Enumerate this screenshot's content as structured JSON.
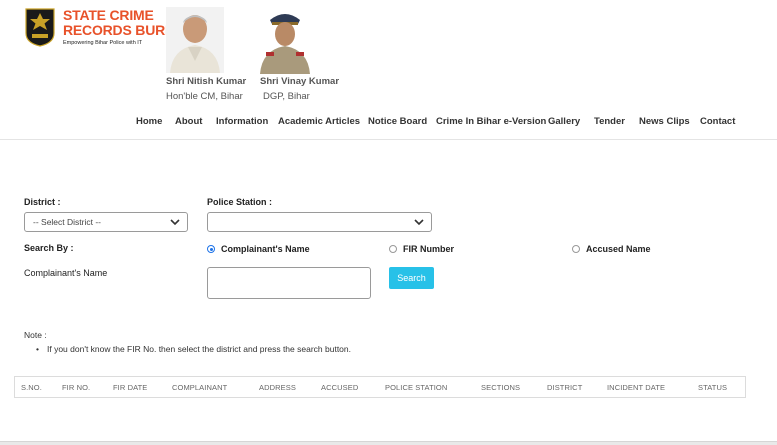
{
  "brand": {
    "line1": "STATE CRIME",
    "line2": "RECORDS BUREAU",
    "tagline": "Empowering Bihar Police with IT",
    "accent_color": "#e8522a",
    "logo_icon": "bihar-police-emblem-icon"
  },
  "officials": [
    {
      "name": "Shri Nitish Kumar",
      "title": "Hon'ble CM, Bihar"
    },
    {
      "name": "Shri Vinay Kumar",
      "title": "DGP, Bihar"
    }
  ],
  "nav": [
    "Home",
    "About",
    "Information",
    "Academic Articles",
    "Notice Board",
    "Crime In Bihar e-Version",
    "Gallery",
    "Tender",
    "News Clips",
    "Contact"
  ],
  "form": {
    "district_label": "District :",
    "district_value": "-- Select District --",
    "police_station_label": "Police Station :",
    "police_station_value": "",
    "search_by_label": "Search By :",
    "search_options": [
      "Complainant's Name",
      "FIR Number",
      "Accused Name"
    ],
    "selected_option": "Complainant's Name",
    "complainant_label": "Complainant's Name",
    "complainant_value": "",
    "search_button": "Search"
  },
  "note": {
    "label": "Note :",
    "text": "If you don't know the FIR No. then select the district and press the search button."
  },
  "table": {
    "headers": [
      "S.NO.",
      "FIR NO.",
      "FIR DATE",
      "COMPLAINANT",
      "ADDRESS",
      "ACCUSED",
      "POLICE STATION",
      "SECTIONS",
      "DISTRICT",
      "INCIDENT DATE",
      "STATUS"
    ]
  },
  "colors": {
    "search_button": "#27c1e8",
    "radio_selected": "#1e73e8"
  }
}
